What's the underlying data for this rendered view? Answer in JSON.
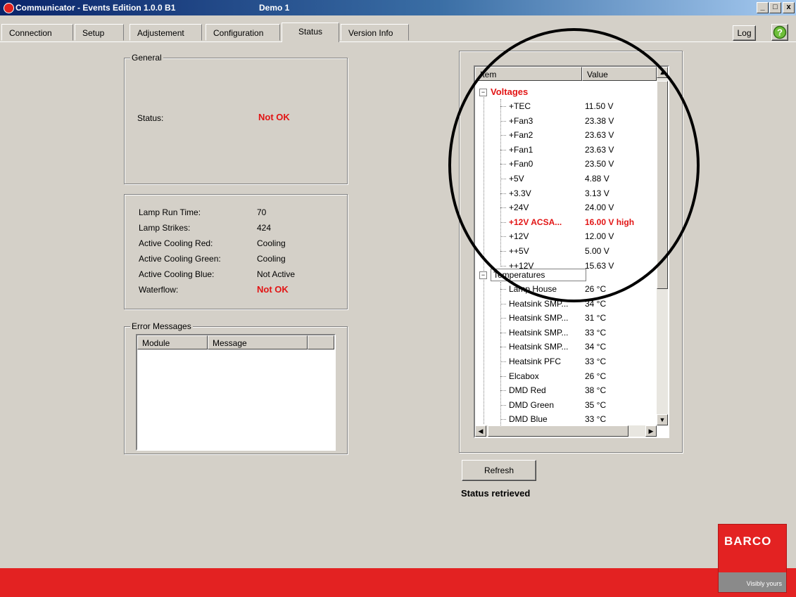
{
  "window": {
    "title": "Communicator - Events Edition 1.0.0 B1",
    "subtitle": "Demo 1",
    "buttons": {
      "minimize": "_",
      "maximize": "□",
      "close": "x"
    }
  },
  "tabs": [
    {
      "label": "Connection"
    },
    {
      "label": "Setup"
    },
    {
      "label": "Adjustement"
    },
    {
      "label": "Configuration"
    },
    {
      "label": "Status",
      "active": true
    },
    {
      "label": "Version Info"
    }
  ],
  "toolbar": {
    "log_label": "Log",
    "help_icon": "help-icon"
  },
  "general": {
    "group_label": "General",
    "status_label": "Status:",
    "status_value": "Not OK"
  },
  "lamp": {
    "rows": [
      {
        "label": "Lamp Run Time:",
        "value": "70"
      },
      {
        "label": "Lamp Strikes:",
        "value": "424"
      },
      {
        "label": "Active Cooling Red:",
        "value": "Cooling"
      },
      {
        "label": "Active Cooling Green:",
        "value": "Cooling"
      },
      {
        "label": "Active Cooling Blue:",
        "value": "Not Active"
      },
      {
        "label": "Waterflow:",
        "value": "Not OK"
      }
    ]
  },
  "errors": {
    "group_label": "Error Messages",
    "columns": [
      "Module",
      "Message"
    ]
  },
  "tree": {
    "columns": [
      "Item",
      "Value"
    ],
    "voltages_label": "Voltages",
    "voltages": [
      {
        "item": "+TEC",
        "value": "11.50 V"
      },
      {
        "item": "+Fan3",
        "value": "23.38 V"
      },
      {
        "item": "+Fan2",
        "value": "23.63 V"
      },
      {
        "item": "+Fan1",
        "value": "23.63 V"
      },
      {
        "item": "+Fan0",
        "value": "23.50 V"
      },
      {
        "item": "+5V",
        "value": "4.88 V"
      },
      {
        "item": "+3.3V",
        "value": "3.13 V"
      },
      {
        "item": "+24V",
        "value": "24.00 V"
      },
      {
        "item": "+12V ACSA...",
        "value": "16.00 V high",
        "error": true
      },
      {
        "item": "+12V",
        "value": "12.00 V"
      },
      {
        "item": "++5V",
        "value": "5.00 V"
      },
      {
        "item": "++12V",
        "value": "15.63 V"
      }
    ],
    "temperatures_label": "Temperatures",
    "temperatures": [
      {
        "item": "Lamp House",
        "value": "26 °C"
      },
      {
        "item": "Heatsink SMP...",
        "value": "34 °C"
      },
      {
        "item": "Heatsink SMP...",
        "value": "31 °C"
      },
      {
        "item": "Heatsink SMP...",
        "value": "33 °C"
      },
      {
        "item": "Heatsink SMP...",
        "value": "34 °C"
      },
      {
        "item": "Heatsink PFC",
        "value": "33 °C"
      },
      {
        "item": "Elcabox",
        "value": "26 °C"
      },
      {
        "item": "DMD Red",
        "value": "38 °C"
      },
      {
        "item": "DMD Green",
        "value": "35 °C"
      },
      {
        "item": "DMD Blue",
        "value": "33 °C"
      }
    ]
  },
  "refresh_label": "Refresh",
  "status_message": "Status retrieved",
  "brand": {
    "name": "BARCO",
    "tagline": "Visibly yours"
  }
}
